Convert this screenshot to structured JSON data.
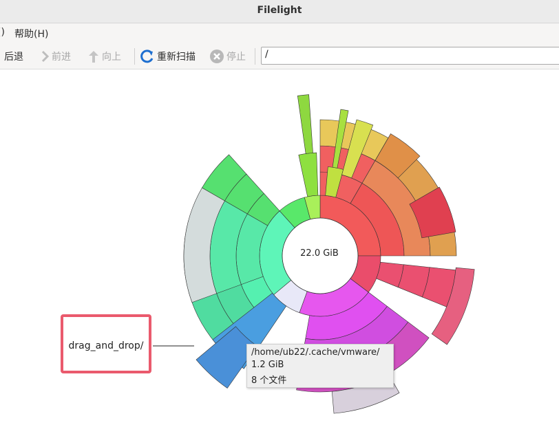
{
  "window": {
    "title": "Filelight"
  },
  "menu": {
    "partial_item": "()",
    "help": "帮助(H)"
  },
  "toolbar": {
    "back": "后退",
    "forward": "前进",
    "up": "向上",
    "rescan": "重新扫描",
    "stop": "停止",
    "location": "/"
  },
  "icons": [
    "back-icon",
    "forward-icon",
    "up-arrow-icon",
    "refresh-icon",
    "stop-icon"
  ],
  "chart": {
    "center_label": "22.0 GiB"
  },
  "callout": {
    "label": "drag_and_drop/",
    "border_color": "#ea5a6d"
  },
  "tooltip": {
    "path": "/home/ub22/.cache/vmware/",
    "size": "1.2 GiB",
    "files": "8 个文件"
  }
}
